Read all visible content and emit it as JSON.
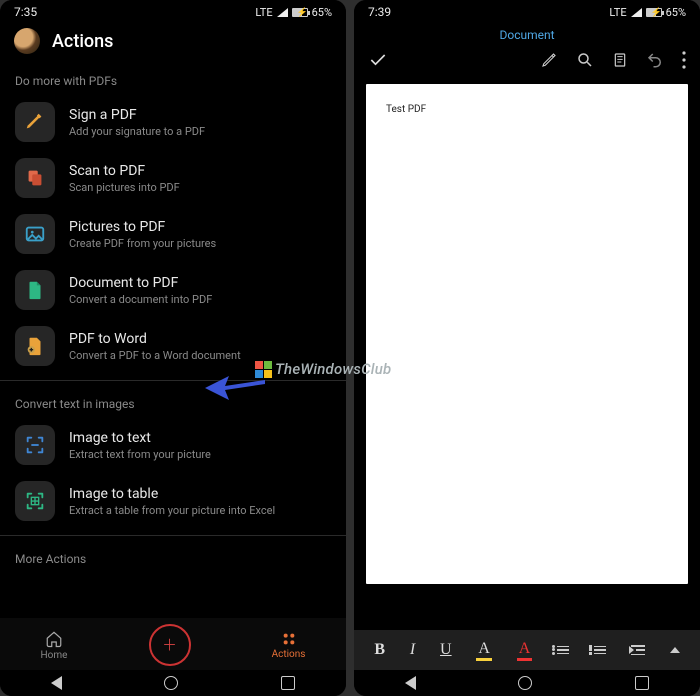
{
  "left": {
    "status": {
      "time": "7:35",
      "net": "LTE",
      "battery": "65%"
    },
    "header": {
      "title": "Actions"
    },
    "section1": {
      "title": "Do more with PDFs",
      "items": [
        {
          "title": "Sign a PDF",
          "sub": "Add your signature to a PDF"
        },
        {
          "title": "Scan to PDF",
          "sub": "Scan pictures into PDF"
        },
        {
          "title": "Pictures to PDF",
          "sub": "Create PDF from your pictures"
        },
        {
          "title": "Document to PDF",
          "sub": "Convert a document into PDF"
        },
        {
          "title": "PDF to Word",
          "sub": "Convert a PDF to a Word document"
        }
      ]
    },
    "section2": {
      "title": "Convert text in images",
      "items": [
        {
          "title": "Image to text",
          "sub": "Extract text from your picture"
        },
        {
          "title": "Image to table",
          "sub": "Extract a table from your picture into Excel"
        }
      ]
    },
    "section3": {
      "title": "More Actions"
    },
    "nav": {
      "home": "Home",
      "actions": "Actions"
    }
  },
  "right": {
    "status": {
      "time": "7:39",
      "net": "LTE",
      "battery": "65%"
    },
    "doc_label": "Document",
    "page_text": "Test PDF",
    "format": {
      "b": "B",
      "i": "I",
      "u": "U",
      "a1": "A",
      "a2": "A"
    }
  },
  "watermark": {
    "brand": "TheWindowsClub"
  }
}
